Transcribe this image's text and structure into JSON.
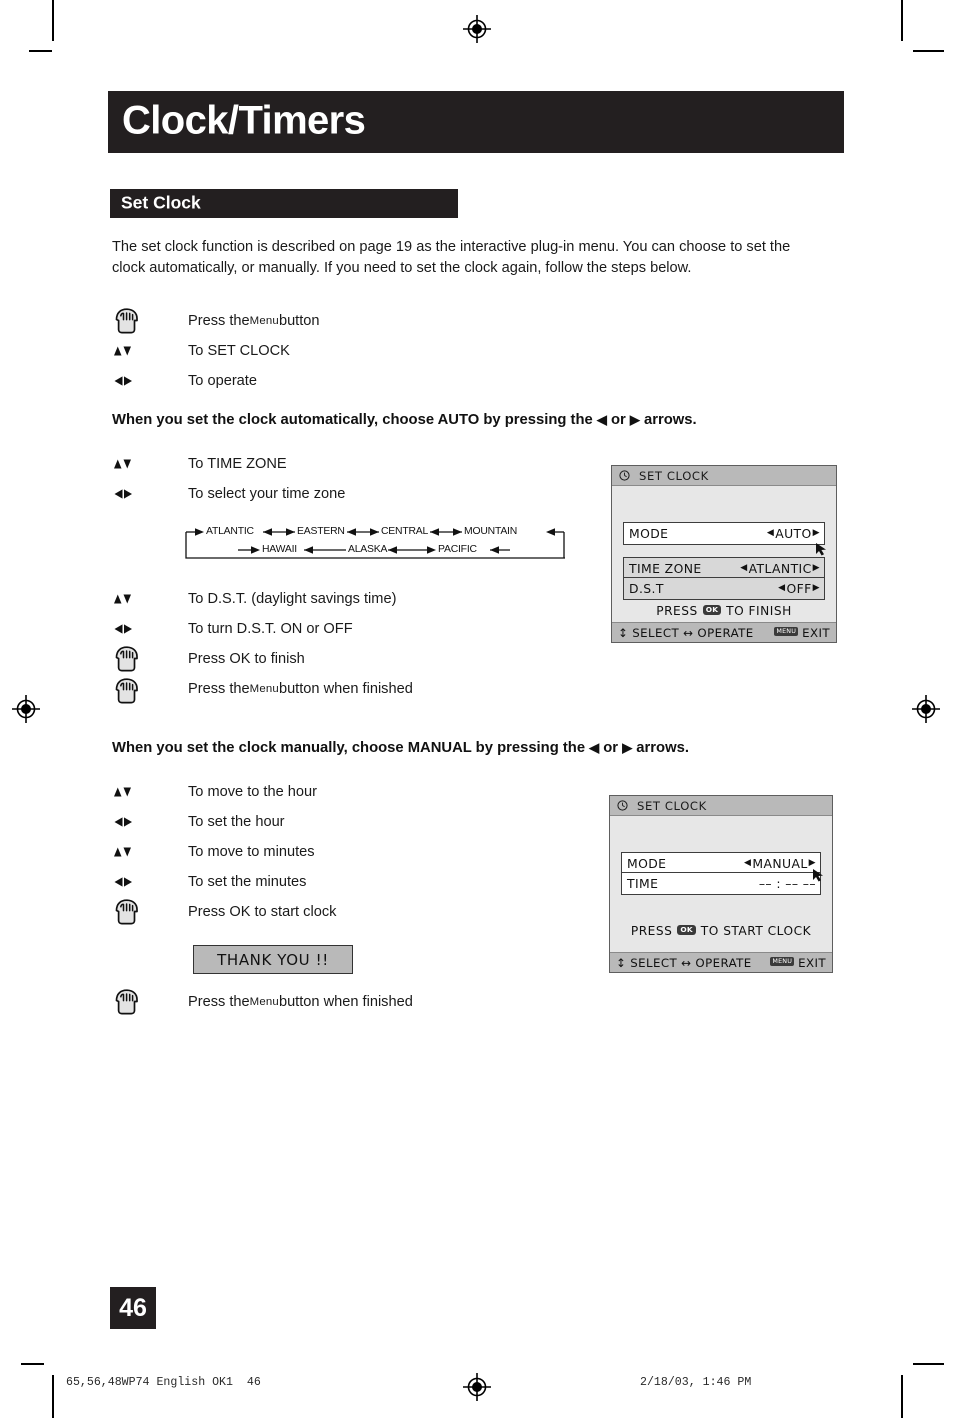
{
  "page": {
    "banner_title": "Clock/Timers",
    "section_title": "Set Clock",
    "number": "46"
  },
  "intro": {
    "paragraph": "The set clock function is described on page 19 as the interactive plug-in menu. You can choose to set the clock automatically, or manually. If you need to set the clock again, follow the steps below."
  },
  "steps_intro": [
    {
      "glyph": "hand-press-icon",
      "text_pre": "Press the ",
      "text_smallcap": "Menu",
      "text_post": " button"
    },
    {
      "glyph": "up-down-arrows-icon",
      "text_pre": "To SET CLOCK",
      "text_smallcap": "",
      "text_post": ""
    },
    {
      "glyph": "left-right-arrows-icon",
      "text_pre": "To operate",
      "text_smallcap": "",
      "text_post": ""
    }
  ],
  "bold_auto": {
    "pre": "When you set the clock automatically, choose AUTO by pressing the ",
    "left_arrow": "◀",
    "mid": " or ",
    "right_arrow": "▶",
    "post": " arrows."
  },
  "steps_auto": [
    {
      "glyph": "up-down-arrows-icon",
      "text_pre": "To TIME ZONE",
      "text_smallcap": "",
      "text_post": ""
    },
    {
      "glyph": "left-right-arrows-icon",
      "text_pre": "To select your time zone",
      "text_smallcap": "",
      "text_post": ""
    }
  ],
  "timezone_diagram": {
    "top_row": [
      "ATLANTIC",
      "EASTERN",
      "CENTRAL",
      "MOUNTAIN"
    ],
    "bottom_row": [
      "HAWAII",
      "ALASKA",
      "PACIFIC"
    ]
  },
  "steps_dst": [
    {
      "glyph": "up-down-arrows-icon",
      "text_pre": "To D.S.T. (daylight savings time)",
      "text_smallcap": "",
      "text_post": ""
    },
    {
      "glyph": "left-right-arrows-icon",
      "text_pre": "To turn D.S.T. ON or OFF",
      "text_smallcap": "",
      "text_post": ""
    },
    {
      "glyph": "hand-press-icon",
      "text_pre": "Press OK to finish",
      "text_smallcap": "",
      "text_post": ""
    },
    {
      "glyph": "hand-press-icon",
      "text_pre": "Press the ",
      "text_smallcap": "Menu",
      "text_post": " button when finished"
    }
  ],
  "bold_manual": {
    "pre": "When you set the clock manually, choose MANUAL by pressing the ",
    "left_arrow": "◀",
    "mid": " or ",
    "right_arrow": "▶",
    "post": " arrows."
  },
  "steps_manual": [
    {
      "glyph": "up-down-arrows-icon",
      "text_pre": "To move to the hour",
      "text_smallcap": "",
      "text_post": ""
    },
    {
      "glyph": "left-right-arrows-icon",
      "text_pre": "To set the hour",
      "text_smallcap": "",
      "text_post": ""
    },
    {
      "glyph": "up-down-arrows-icon",
      "text_pre": "To move to minutes",
      "text_smallcap": "",
      "text_post": ""
    },
    {
      "glyph": "left-right-arrows-icon",
      "text_pre": "To set the minutes",
      "text_smallcap": "",
      "text_post": ""
    },
    {
      "glyph": "hand-press-icon",
      "text_pre": "Press OK to start clock",
      "text_smallcap": "",
      "text_post": ""
    }
  ],
  "thank_you": {
    "label": "THANK YOU !!"
  },
  "steps_final": [
    {
      "glyph": "hand-press-icon",
      "text_pre": "Press the ",
      "text_smallcap": "Menu",
      "text_post": " button when finished"
    }
  ],
  "osd_auto": {
    "title": "SET CLOCK",
    "rows": [
      {
        "label": "MODE",
        "value": "AUTO",
        "left_caret": "◀",
        "right_caret": "▶"
      },
      {
        "label": "TIME ZONE",
        "value": "ATLANTIC",
        "left_caret": "◀",
        "right_caret": "▶"
      },
      {
        "label": "D.S.T",
        "value": "OFF",
        "left_caret": "◀",
        "right_caret": "▶"
      }
    ],
    "hint_pre": "PRESS",
    "hint_badge": "OK",
    "hint_post": "TO FINISH",
    "bottom_select": "SELECT",
    "bottom_operate": "OPERATE",
    "bottom_exit": "EXIT",
    "bottom_menu_badge": "MENU",
    "bottom_updown_glyph": "↕",
    "bottom_leftright_glyph": "↔"
  },
  "osd_manual": {
    "title": "SET CLOCK",
    "rows": [
      {
        "label": "MODE",
        "value": "MANUAL",
        "left_caret": "◀",
        "right_caret": "▶"
      },
      {
        "label": "TIME",
        "value": "–– : ––   ––",
        "left_caret": "",
        "right_caret": ""
      }
    ],
    "hint_pre": "PRESS",
    "hint_badge": "OK",
    "hint_post": "TO START CLOCK",
    "bottom_select": "SELECT",
    "bottom_operate": "OPERATE",
    "bottom_exit": "EXIT",
    "bottom_menu_badge": "MENU",
    "bottom_updown_glyph": "↕",
    "bottom_leftright_glyph": "↔"
  },
  "footer": {
    "left": "65,56,48WP74 English OK1  46",
    "right": "2/18/03, 1:46 PM"
  },
  "colors": {
    "banner_black": "#231f20",
    "osd_body": "#e7e7e7",
    "osd_bar": "#b9b9b9",
    "osd_row_gray": "#d8d8d8",
    "page_white": "#ffffff"
  }
}
